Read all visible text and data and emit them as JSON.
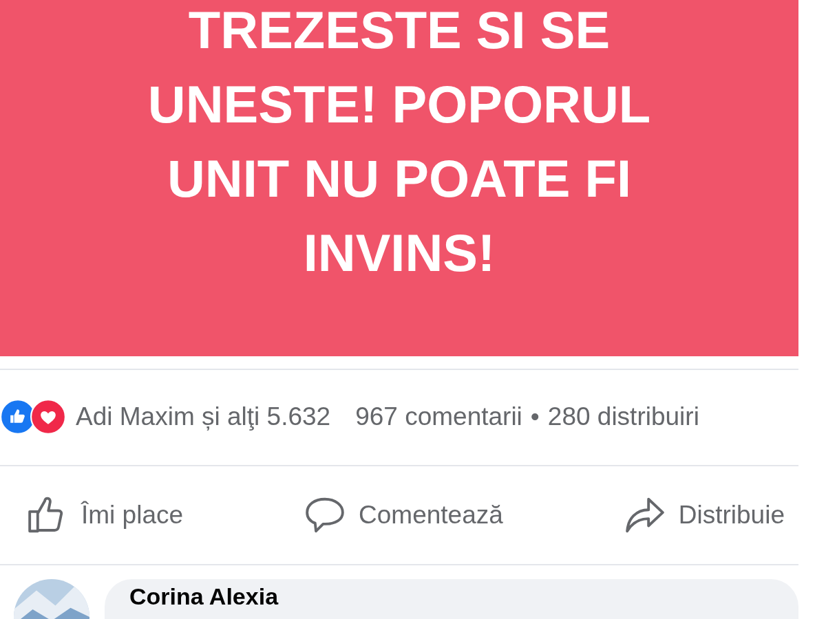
{
  "post": {
    "text": "TREZESTE SI SE UNESTE! POPORUL UNIT NU POATE FI INVINS!"
  },
  "stats": {
    "reactions": [
      {
        "kind": "like"
      },
      {
        "kind": "love"
      }
    ],
    "reactors": "Adi Maxim și alţi 5.632",
    "comments": "967 comentarii",
    "separator": "•",
    "shares": "280 distribuiri"
  },
  "actions": [
    {
      "kind": "like",
      "label": "Îmi place"
    },
    {
      "kind": "comment",
      "label": "Comentează"
    },
    {
      "kind": "share",
      "label": "Distribuie"
    }
  ],
  "comment": {
    "author": "Corina Alexia"
  }
}
